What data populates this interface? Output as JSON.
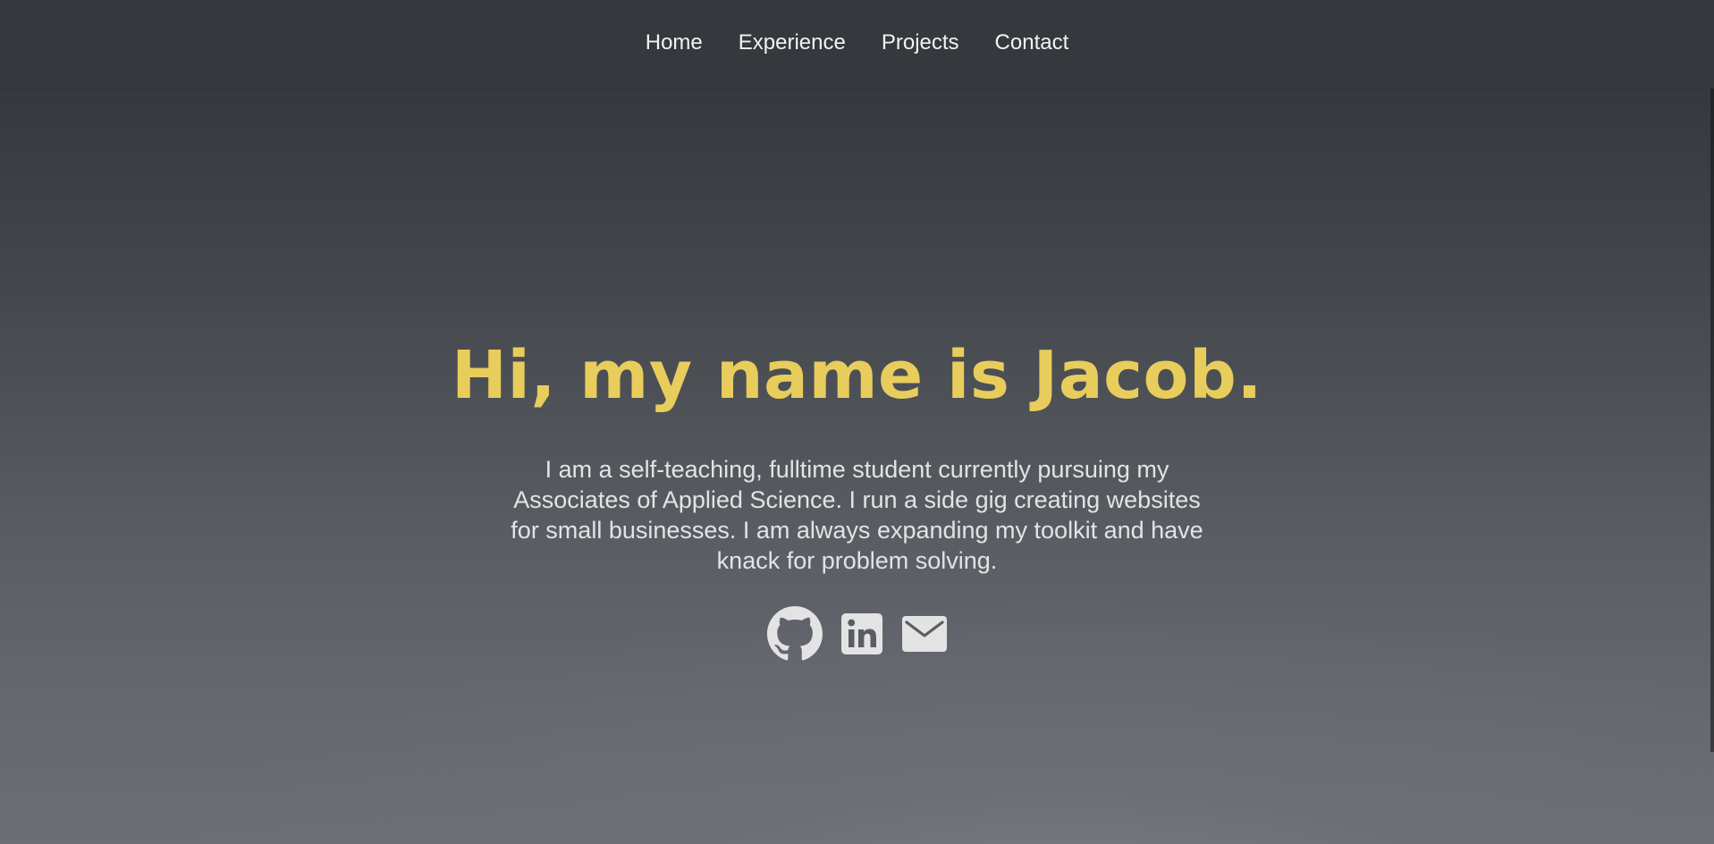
{
  "nav": {
    "items": [
      {
        "label": "Home"
      },
      {
        "label": "Experience"
      },
      {
        "label": "Projects"
      },
      {
        "label": "Contact"
      }
    ]
  },
  "hero": {
    "title": "Hi, my name is Jacob.",
    "description": "I am a self-teaching, fulltime student currently pursuing my Associates of Applied Science. I run a side gig creating websites for small businesses. I am always expanding my toolkit and have knack for problem solving."
  },
  "socials": {
    "items": [
      {
        "icon": "github-icon"
      },
      {
        "icon": "linkedin-icon"
      },
      {
        "icon": "email-icon"
      }
    ]
  },
  "colors": {
    "accent": "#e8cd5d",
    "nav_background": "#35383c",
    "text": "#e3e3e3"
  }
}
